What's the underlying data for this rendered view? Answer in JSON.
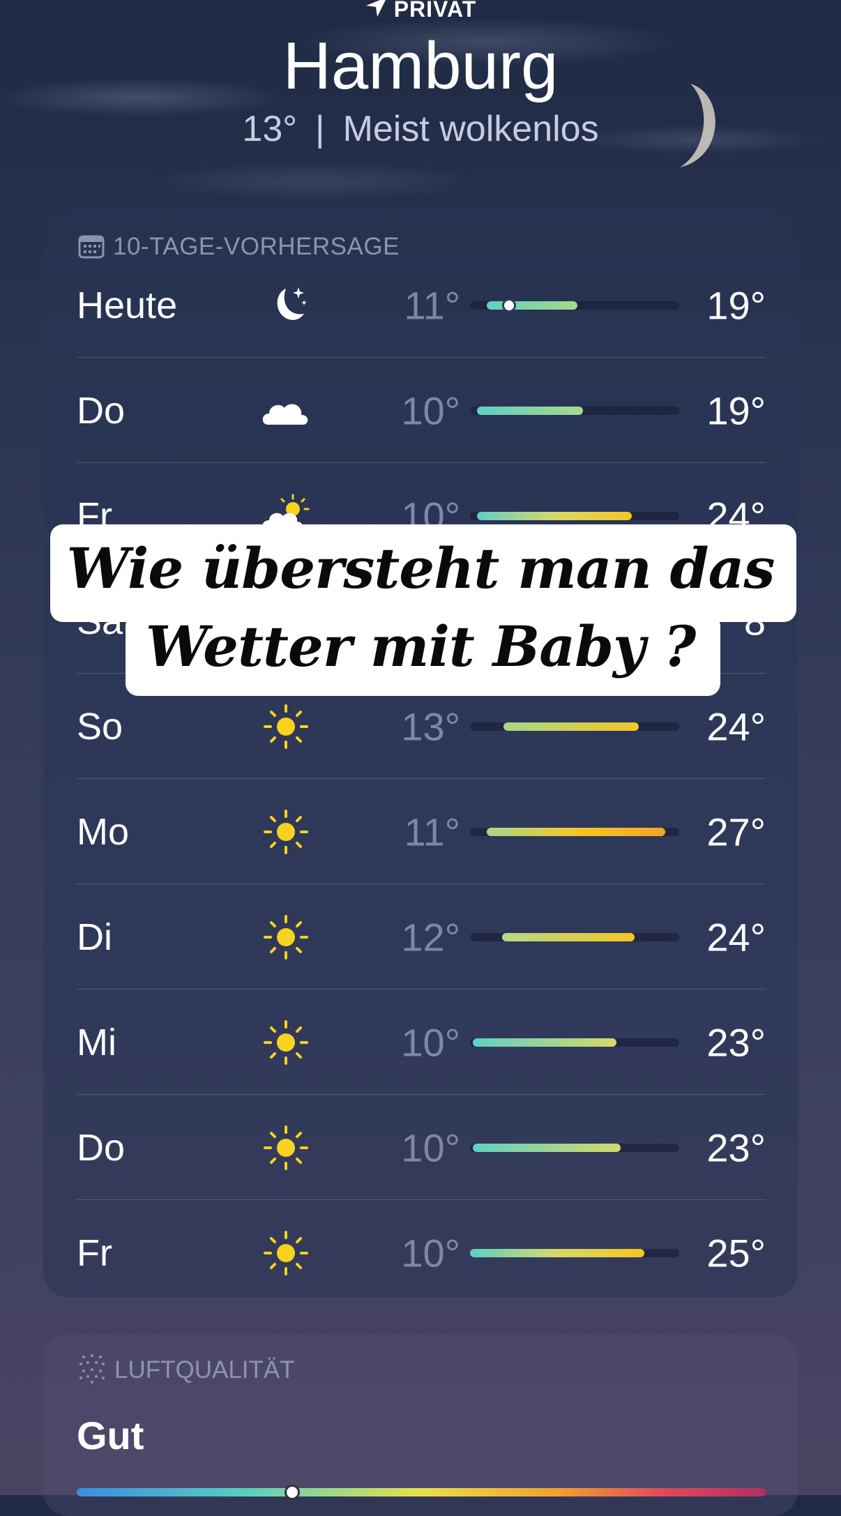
{
  "header": {
    "location_label": "PRIVAT",
    "city": "Hamburg",
    "current_temp": "13°",
    "condition": "Meist wolkenlos"
  },
  "forecast": {
    "title": "10-TAGE-VORHERSAGE",
    "days": [
      {
        "day": "Heute",
        "icon": "moon-stars-icon",
        "low": "11°",
        "high": "19°"
      },
      {
        "day": "Do",
        "icon": "cloud-icon",
        "low": "10°",
        "high": "19°"
      },
      {
        "day": "Fr",
        "icon": "sun-cloud-icon",
        "low": "10°",
        "high": "24°"
      },
      {
        "day": "Sa",
        "icon": "sun-icon",
        "low": "",
        "high": "8"
      },
      {
        "day": "So",
        "icon": "sun-icon",
        "low": "13°",
        "high": "24°"
      },
      {
        "day": "Mo",
        "icon": "sun-icon",
        "low": "11°",
        "high": "27°"
      },
      {
        "day": "Di",
        "icon": "sun-icon",
        "low": "12°",
        "high": "24°"
      },
      {
        "day": "Mi",
        "icon": "sun-icon",
        "low": "10°",
        "high": "23°"
      },
      {
        "day": "Do",
        "icon": "sun-icon",
        "low": "10°",
        "high": "23°"
      },
      {
        "day": "Fr",
        "icon": "sun-icon",
        "low": "10°",
        "high": "25°"
      }
    ]
  },
  "air_quality": {
    "title": "LUFTQUALITÄT",
    "value": "Gut"
  },
  "caption": {
    "line1": "Wie übersteht man das",
    "line2": "Wetter mit Baby ?"
  },
  "colors": {
    "cool": "#5fd0c4",
    "warm": "#f5c623",
    "hot": "#f5a623",
    "sun": "#f7d21e"
  }
}
